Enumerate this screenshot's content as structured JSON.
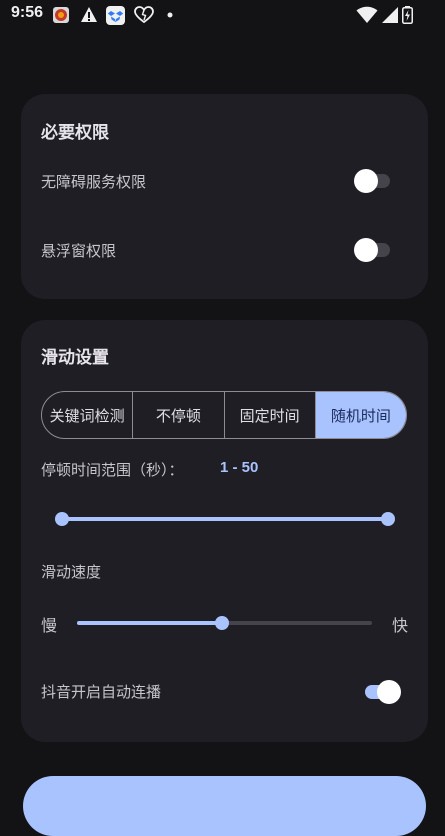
{
  "status_bar": {
    "time": "9:56",
    "icons": [
      "app-notification-icon",
      "warning-icon",
      "dropbox-icon",
      "heart-icon",
      "dot-icon",
      "wifi-icon",
      "signal-icon",
      "battery-charging-icon"
    ]
  },
  "permissions": {
    "title": "必要权限",
    "accessibility_label": "无障碍服务权限",
    "accessibility_enabled": false,
    "overlay_label": "悬浮窗权限",
    "overlay_enabled": false
  },
  "scroll_settings": {
    "title": "滑动设置",
    "modes": [
      {
        "label": "关键词检测",
        "selected": false
      },
      {
        "label": "不停顿",
        "selected": false
      },
      {
        "label": "固定时间",
        "selected": false
      },
      {
        "label": "随机时间",
        "selected": true
      }
    ],
    "pause_range_label": "停顿时间范围（秒）：",
    "pause_range_value": "1 - 50",
    "pause_range_fraction": [
      0,
      1
    ],
    "speed_label": "滑动速度",
    "speed_slow": "慢",
    "speed_fast": "快",
    "speed_fraction": 0.49,
    "douyin_autoplay_label": "抖音开启自动连播",
    "douyin_autoplay_enabled": true
  },
  "colors": {
    "accent": "#a9c3ff",
    "background": "#131316",
    "card": "#1f1e24"
  }
}
